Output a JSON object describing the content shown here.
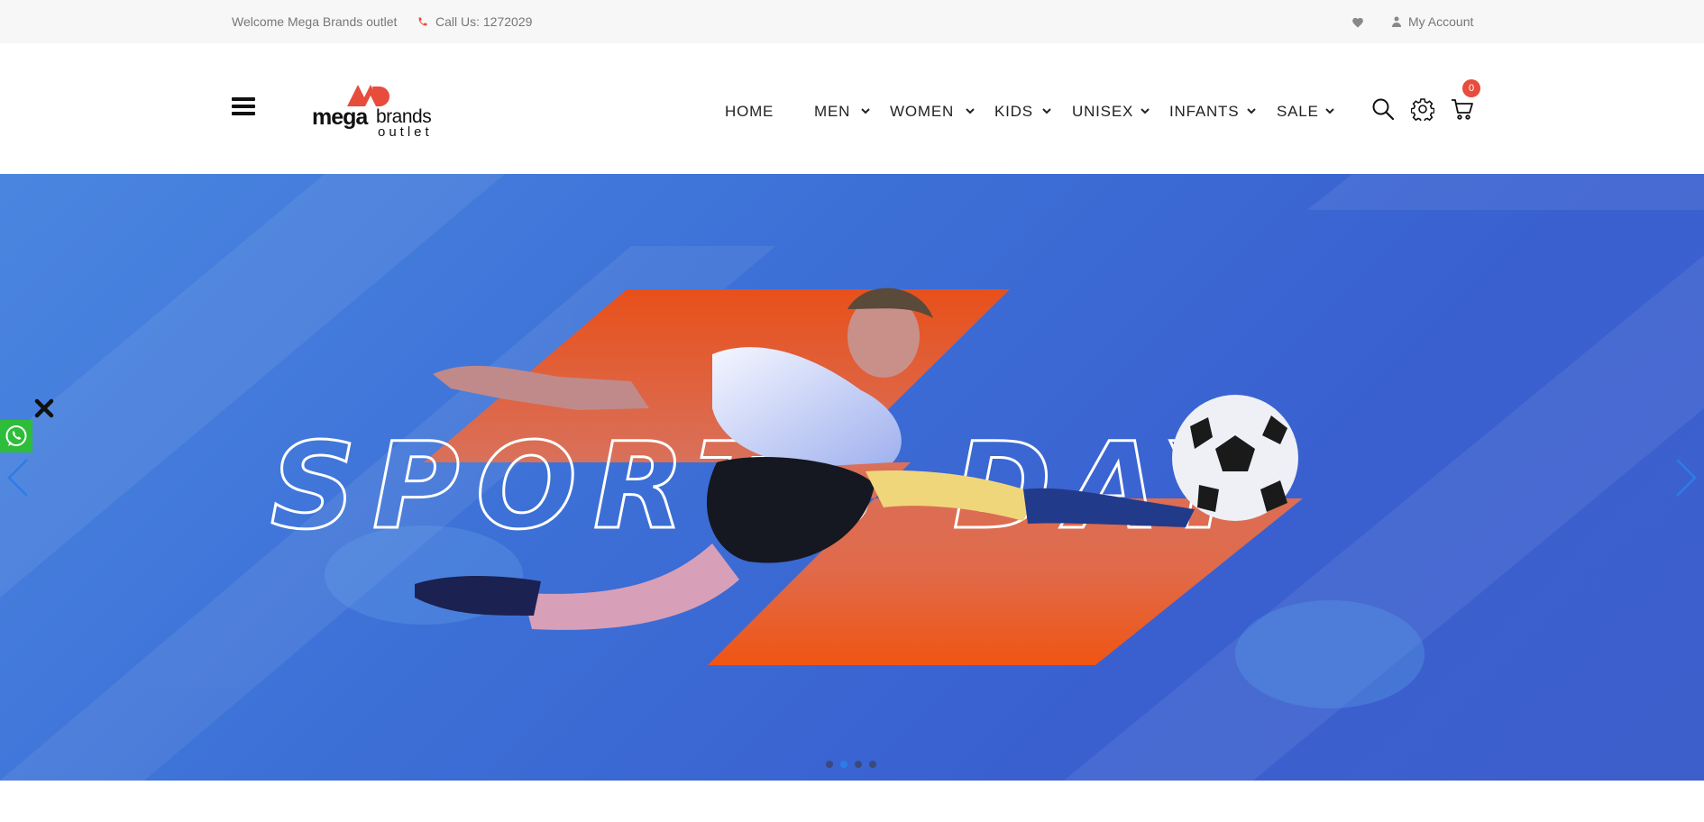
{
  "topbar": {
    "welcome": "Welcome Mega Brands outlet",
    "phone": "Call Us: 1272029",
    "account": "My Account"
  },
  "logo": {
    "line1_a": "mega",
    "line1_b": "brands",
    "line2": "outlet"
  },
  "nav": {
    "items": [
      {
        "label": "HOME",
        "has_dropdown": false
      },
      {
        "label": "MEN",
        "has_dropdown": true
      },
      {
        "label": "WOMEN",
        "has_dropdown": true
      },
      {
        "label": "KIDS",
        "has_dropdown": true
      },
      {
        "label": "UNISEX",
        "has_dropdown": true
      },
      {
        "label": "INFANTS",
        "has_dropdown": true
      },
      {
        "label": "SALE",
        "has_dropdown": true
      }
    ]
  },
  "cart": {
    "count": "0"
  },
  "hero": {
    "headline": "SPORTS DAY",
    "slide_count": 4,
    "active_slide": 2
  },
  "colors": {
    "accent": "#e74c3c",
    "hero_blue": "#3c6fd6",
    "hero_orange": "#e8501a",
    "whatsapp": "#2ebd3a",
    "arrow_blue": "#2b7de9"
  }
}
